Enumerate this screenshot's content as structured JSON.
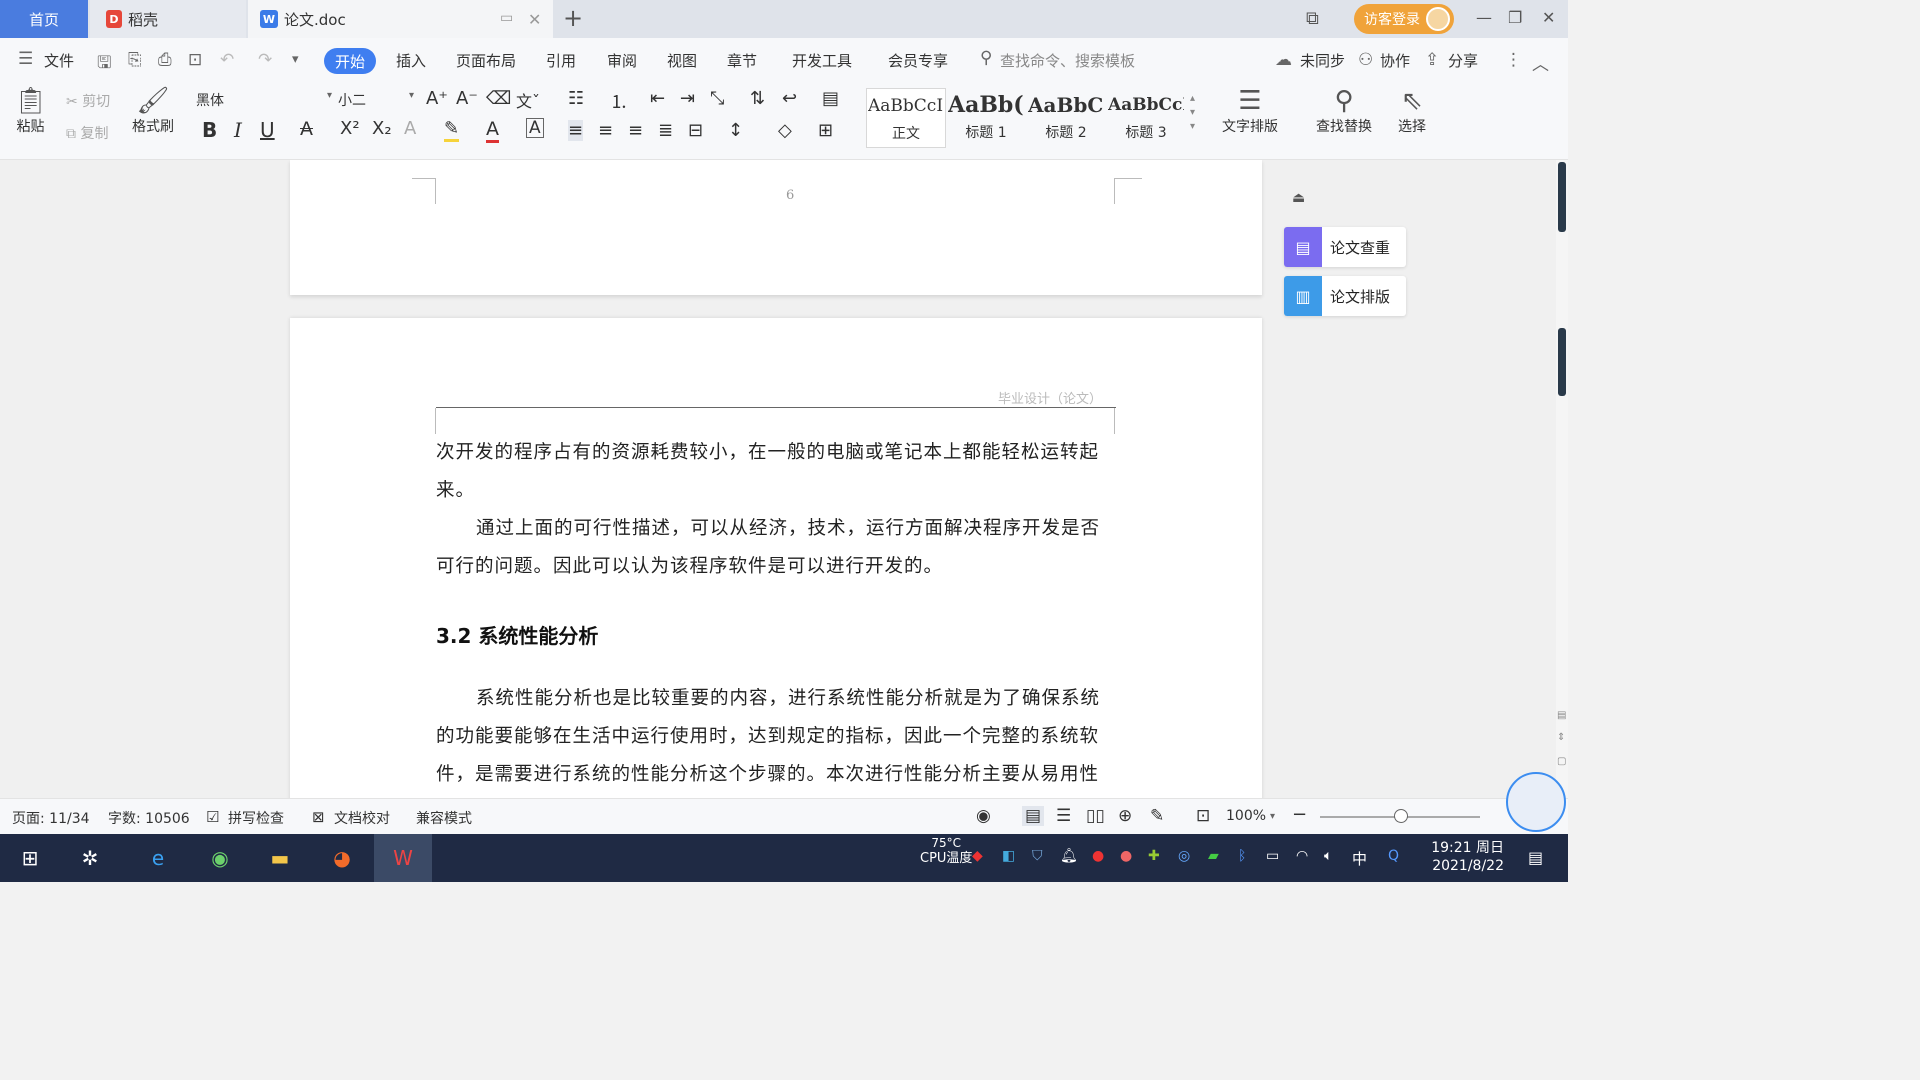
{
  "tabs": {
    "home": "首页",
    "daoke": "稻壳",
    "doc": "论文.doc"
  },
  "titlebar": {
    "login": "访客登录"
  },
  "menu": {
    "file": "文件",
    "items": [
      "开始",
      "插入",
      "页面布局",
      "引用",
      "审阅",
      "视图",
      "章节",
      "开发工具",
      "会员专享"
    ],
    "search_placeholder": "查找命令、搜索模板",
    "sync": "未同步",
    "collab": "协作",
    "share": "分享"
  },
  "ribbon": {
    "paste": "粘贴",
    "cut": "剪切",
    "copy": "复制",
    "format_painter": "格式刷",
    "font_name": "黑体",
    "font_size": "小二",
    "styles": [
      {
        "preview": "AaBbCcI",
        "name": "正文"
      },
      {
        "preview": "AaBb(",
        "name": "标题 1"
      },
      {
        "preview": "AaBbC",
        "name": "标题 2"
      },
      {
        "preview": "AaBbCcI",
        "name": "标题 3"
      }
    ],
    "text_layout": "文字排版",
    "find_replace": "查找替换",
    "select": "选择"
  },
  "document": {
    "prev_page_number": "6",
    "header_text": "毕业设计（论文）",
    "paragraphs": [
      "次开发的程序占有的资源耗费较小，在一般的电脑或笔记本上都能轻松运转起来。",
      "通过上面的可行性描述，可以从经济，技术，运行方面解决程序开发是否可行的问题。因此可以认为该程序软件是可以进行开发的。"
    ],
    "heading": "3.2  系统性能分析",
    "paragraph3": "系统性能分析也是比较重要的内容，进行系统性能分析就是为了确保系统的功能要能够在生活中运行使用时，达到规定的指标，因此一个完整的系统软件，是需要进行系统的性能分析这个步骤的。本次进行性能分析主要从易用性指标，"
  },
  "side_panel": {
    "check": "论文查重",
    "layout": "论文排版"
  },
  "statusbar": {
    "page": "页面: 11/34",
    "words": "字数: 10506",
    "spell": "拼写检查",
    "proof": "文档校对",
    "compat": "兼容模式",
    "zoom": "100%"
  },
  "taskbar": {
    "cpu_temp": "75°C",
    "cpu_label": "CPU温度",
    "ime": "中",
    "time": "19:21 周日",
    "date": "2021/8/22"
  }
}
